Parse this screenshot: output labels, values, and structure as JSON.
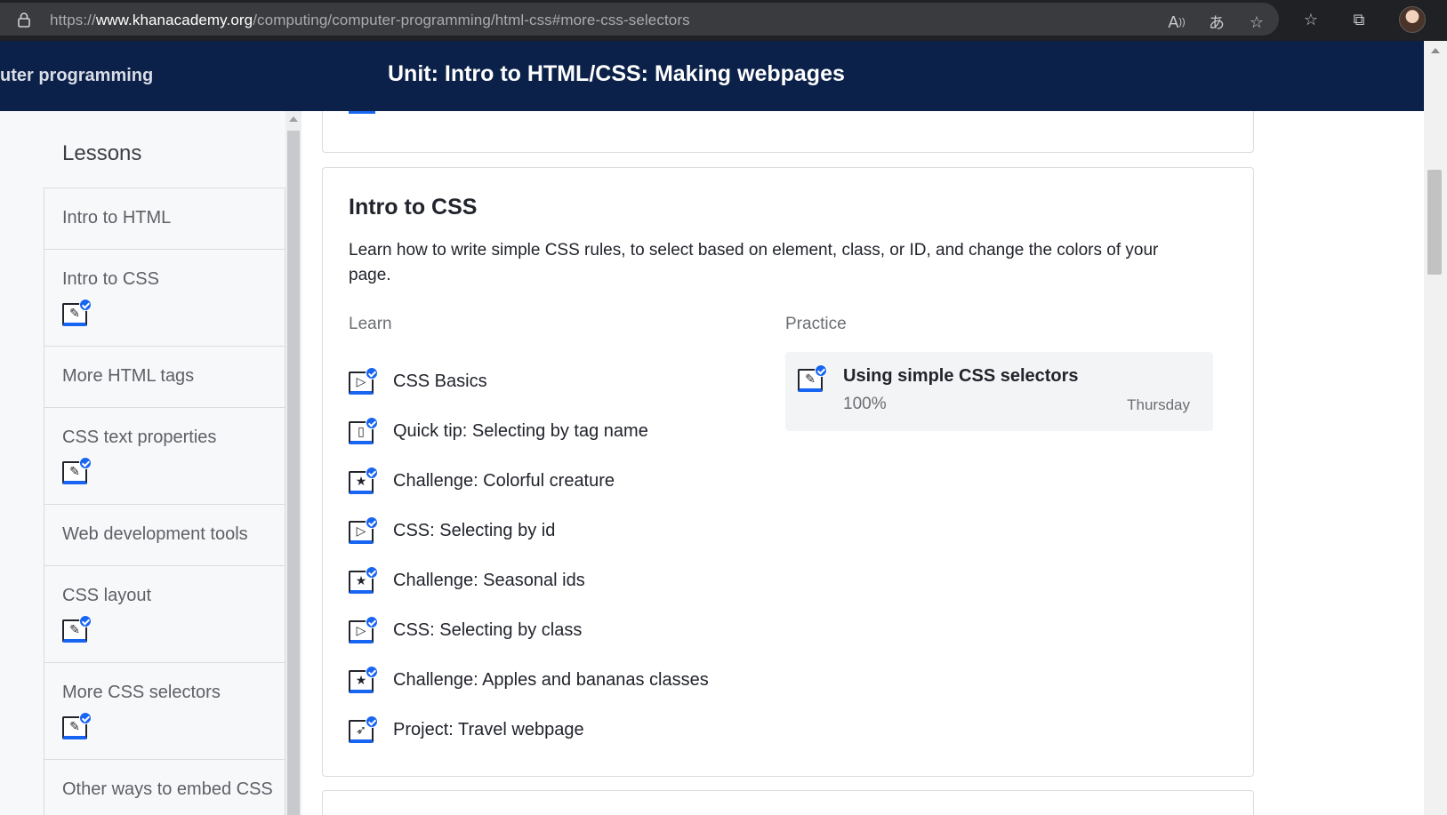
{
  "browser": {
    "url_prefix": "https://",
    "url_host": "www.khanacademy.org",
    "url_path": "/computing/computer-programming/html-css#more-css-selectors",
    "icons": [
      "lock-icon",
      "read-aloud-icon",
      "translate-icon",
      "add-favorite-icon",
      "favorites-icon",
      "collections-icon",
      "profile-avatar"
    ]
  },
  "header": {
    "breadcrumb": "uter programming",
    "unit_title": "Unit: Intro to HTML/CSS: Making webpages"
  },
  "sidebar": {
    "title": "Lessons",
    "items": [
      {
        "label": "Intro to HTML",
        "has_icon": false
      },
      {
        "label": "Intro to CSS",
        "has_icon": true,
        "icon": "pencil-icon"
      },
      {
        "label": "More HTML tags",
        "has_icon": false
      },
      {
        "label": "CSS text properties",
        "has_icon": true,
        "icon": "pencil-icon"
      },
      {
        "label": "Web development tools",
        "has_icon": false
      },
      {
        "label": "CSS layout",
        "has_icon": true,
        "icon": "pencil-icon"
      },
      {
        "label": "More CSS selectors",
        "has_icon": true,
        "icon": "pencil-icon"
      },
      {
        "label": "Other ways to embed CSS",
        "has_icon": false
      }
    ]
  },
  "section": {
    "title": "Intro to CSS",
    "description": "Learn how to write simple CSS rules, to select based on element, class, or ID, and change the colors of your page.",
    "learn_heading": "Learn",
    "practice_heading": "Practice",
    "learn_items": [
      {
        "label": "CSS Basics",
        "icon": "video-icon",
        "glyph": "▷"
      },
      {
        "label": "Quick tip: Selecting by tag name",
        "icon": "article-icon",
        "glyph": "▯"
      },
      {
        "label": "Challenge: Colorful creature",
        "icon": "challenge-star-icon",
        "glyph": "★"
      },
      {
        "label": "CSS: Selecting by id",
        "icon": "video-icon",
        "glyph": "▷"
      },
      {
        "label": "Challenge: Seasonal ids",
        "icon": "challenge-star-icon",
        "glyph": "★"
      },
      {
        "label": "CSS: Selecting by class",
        "icon": "video-icon",
        "glyph": "▷"
      },
      {
        "label": "Challenge: Apples and bananas classes",
        "icon": "challenge-star-icon",
        "glyph": "★"
      },
      {
        "label": "Project: Travel webpage",
        "icon": "project-rocket-icon",
        "glyph": "➶"
      }
    ],
    "practice": {
      "title": "Using simple CSS selectors",
      "score": "100%",
      "date": "Thursday",
      "icon": "pencil-icon"
    }
  },
  "colors": {
    "header_navy": "#0b2149",
    "accent_blue": "#1865f2",
    "text_dark": "#21242c",
    "text_muted": "#6b6e73"
  }
}
